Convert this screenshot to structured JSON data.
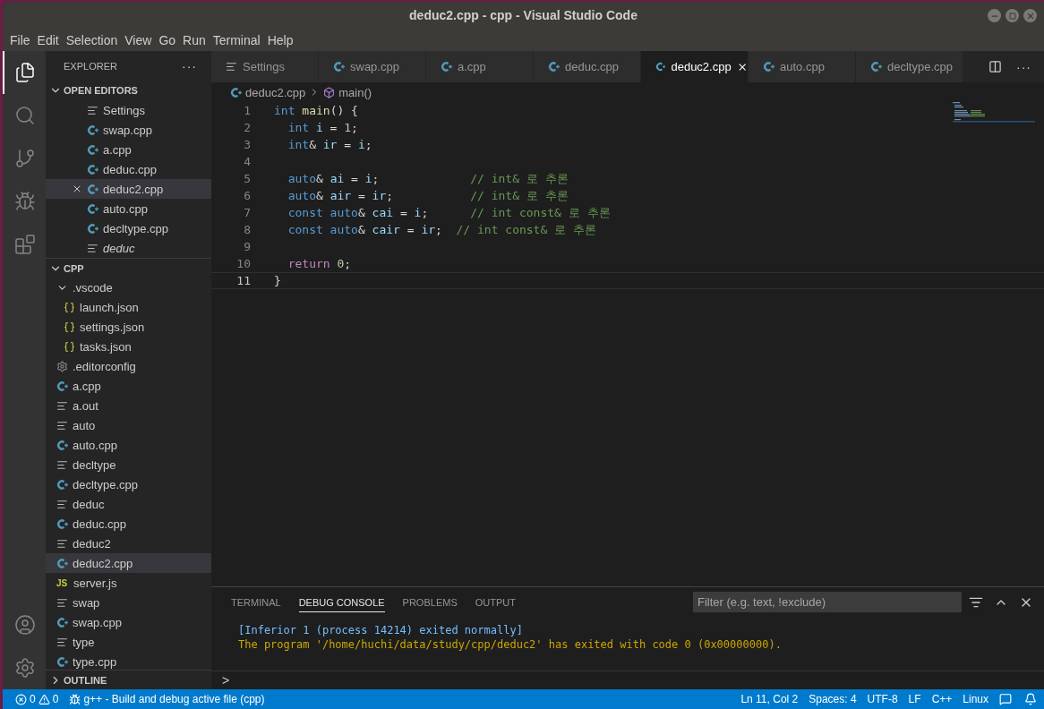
{
  "window": {
    "title": "deduc2.cpp - cpp - Visual Studio Code"
  },
  "menu": [
    "File",
    "Edit",
    "Selection",
    "View",
    "Go",
    "Run",
    "Terminal",
    "Help"
  ],
  "activity_bar": [
    {
      "kind": "files",
      "selected": true
    },
    {
      "kind": "search",
      "selected": false
    },
    {
      "kind": "source-control",
      "selected": false
    },
    {
      "kind": "debug",
      "selected": false
    },
    {
      "kind": "extensions",
      "selected": false
    }
  ],
  "sidebar": {
    "title": "EXPLORER",
    "more": "···",
    "open_editors": {
      "title": "OPEN EDITORS",
      "expanded": true,
      "items": [
        {
          "label": "Settings",
          "kind": "settings",
          "selected": false,
          "preview": false
        },
        {
          "label": "swap.cpp",
          "kind": "cpp",
          "selected": false,
          "preview": false
        },
        {
          "label": "a.cpp",
          "kind": "cpp",
          "selected": false,
          "preview": false
        },
        {
          "label": "deduc.cpp",
          "kind": "cpp",
          "selected": false,
          "preview": false
        },
        {
          "label": "deduc2.cpp",
          "kind": "cpp",
          "selected": true,
          "preview": false
        },
        {
          "label": "auto.cpp",
          "kind": "cpp",
          "selected": false,
          "preview": false
        },
        {
          "label": "decltype.cpp",
          "kind": "cpp",
          "selected": false,
          "preview": false
        },
        {
          "label": "deduc",
          "kind": "file",
          "selected": false,
          "preview": true
        }
      ]
    },
    "folder": {
      "title": "CPP",
      "expanded": true,
      "items": [
        {
          "label": ".vscode",
          "kind": "folder",
          "expanded": true,
          "selected": false,
          "children": [
            {
              "label": "launch.json",
              "kind": "json",
              "selected": false
            },
            {
              "label": "settings.json",
              "kind": "json",
              "selected": false
            },
            {
              "label": "tasks.json",
              "kind": "json",
              "selected": false
            }
          ]
        },
        {
          "label": ".editorconfig",
          "kind": "gear",
          "selected": false
        },
        {
          "label": "a.cpp",
          "kind": "cpp",
          "selected": false
        },
        {
          "label": "a.out",
          "kind": "file",
          "selected": false
        },
        {
          "label": "auto",
          "kind": "file",
          "selected": false
        },
        {
          "label": "auto.cpp",
          "kind": "cpp",
          "selected": false
        },
        {
          "label": "decltype",
          "kind": "file",
          "selected": false
        },
        {
          "label": "decltype.cpp",
          "kind": "cpp",
          "selected": false
        },
        {
          "label": "deduc",
          "kind": "file",
          "selected": false
        },
        {
          "label": "deduc.cpp",
          "kind": "cpp",
          "selected": false
        },
        {
          "label": "deduc2",
          "kind": "file",
          "selected": false
        },
        {
          "label": "deduc2.cpp",
          "kind": "cpp",
          "selected": true
        },
        {
          "label": "server.js",
          "kind": "js",
          "badge": "JS",
          "selected": false
        },
        {
          "label": "swap",
          "kind": "file",
          "selected": false
        },
        {
          "label": "swap.cpp",
          "kind": "cpp",
          "selected": false
        },
        {
          "label": "type",
          "kind": "file",
          "selected": false
        },
        {
          "label": "type.cpp",
          "kind": "cpp",
          "selected": false
        }
      ]
    },
    "outline": {
      "title": "OUTLINE",
      "expanded": false
    }
  },
  "tabs": [
    {
      "label": "Settings",
      "kind": "settings",
      "selected": false
    },
    {
      "label": "swap.cpp",
      "kind": "cpp",
      "selected": false
    },
    {
      "label": "a.cpp",
      "kind": "cpp",
      "selected": false
    },
    {
      "label": "deduc.cpp",
      "kind": "cpp",
      "selected": false
    },
    {
      "label": "deduc2.cpp",
      "kind": "cpp",
      "selected": true
    },
    {
      "label": "auto.cpp",
      "kind": "cpp",
      "selected": false
    },
    {
      "label": "decltype.cpp",
      "kind": "cpp",
      "selected": false
    }
  ],
  "tab_actions": {
    "more": "···"
  },
  "breadcrumb": {
    "file": "deduc2.cpp",
    "symbol": "main()"
  },
  "code": [
    {
      "number": "1",
      "current": false,
      "tokens": [
        {
          "text": "int ",
          "kind": "keyword"
        },
        {
          "text": "main",
          "kind": "func"
        },
        {
          "text": "() {",
          "kind": "plain"
        }
      ]
    },
    {
      "number": "2",
      "current": false,
      "tokens": [
        {
          "text": "  int ",
          "kind": "keyword"
        },
        {
          "text": "i",
          "kind": "var"
        },
        {
          "text": " = ",
          "kind": "plain"
        },
        {
          "text": "1",
          "kind": "num"
        },
        {
          "text": ";",
          "kind": "plain"
        }
      ]
    },
    {
      "number": "3",
      "current": false,
      "tokens": [
        {
          "text": "  int",
          "kind": "keyword"
        },
        {
          "text": "& ",
          "kind": "plain"
        },
        {
          "text": "ir",
          "kind": "var"
        },
        {
          "text": " = ",
          "kind": "plain"
        },
        {
          "text": "i",
          "kind": "var"
        },
        {
          "text": ";",
          "kind": "plain"
        }
      ]
    },
    {
      "number": "4",
      "current": false
    },
    {
      "number": "5",
      "current": false,
      "tokens": [
        {
          "text": "  auto",
          "kind": "keyword"
        },
        {
          "text": "& ",
          "kind": "plain"
        },
        {
          "text": "ai",
          "kind": "var"
        },
        {
          "text": " = ",
          "kind": "plain"
        },
        {
          "text": "i",
          "kind": "var"
        },
        {
          "text": ";             ",
          "kind": "plain"
        },
        {
          "text": "// int& 로 추론",
          "kind": "comment"
        }
      ]
    },
    {
      "number": "6",
      "current": false,
      "tokens": [
        {
          "text": "  auto",
          "kind": "keyword"
        },
        {
          "text": "& ",
          "kind": "plain"
        },
        {
          "text": "air",
          "kind": "var"
        },
        {
          "text": " = ",
          "kind": "plain"
        },
        {
          "text": "ir",
          "kind": "var"
        },
        {
          "text": ";           ",
          "kind": "plain"
        },
        {
          "text": "// int& 로 추론",
          "kind": "comment"
        }
      ]
    },
    {
      "number": "7",
      "current": false,
      "tokens": [
        {
          "text": "  const auto",
          "kind": "keyword"
        },
        {
          "text": "& ",
          "kind": "plain"
        },
        {
          "text": "cai",
          "kind": "var"
        },
        {
          "text": " = ",
          "kind": "plain"
        },
        {
          "text": "i",
          "kind": "var"
        },
        {
          "text": ";      ",
          "kind": "plain"
        },
        {
          "text": "// int const& 로 추론",
          "kind": "comment"
        }
      ]
    },
    {
      "number": "8",
      "current": false,
      "tokens": [
        {
          "text": "  const auto",
          "kind": "keyword"
        },
        {
          "text": "& ",
          "kind": "plain"
        },
        {
          "text": "cair",
          "kind": "var"
        },
        {
          "text": " = ",
          "kind": "plain"
        },
        {
          "text": "ir",
          "kind": "var"
        },
        {
          "text": ";  ",
          "kind": "plain"
        },
        {
          "text": "// int const& 로 추론",
          "kind": "comment"
        }
      ]
    },
    {
      "number": "9",
      "current": false
    },
    {
      "number": "10",
      "current": false,
      "tokens": [
        {
          "text": "  return ",
          "kind": "control"
        },
        {
          "text": "0",
          "kind": "num"
        },
        {
          "text": ";",
          "kind": "plain"
        }
      ]
    },
    {
      "number": "11",
      "current": true,
      "tokens": [
        {
          "text": "}",
          "kind": "plain"
        }
      ]
    }
  ],
  "panel": {
    "tabs": [
      {
        "label": "TERMINAL",
        "selected": false
      },
      {
        "label": "DEBUG CONSOLE",
        "selected": true
      },
      {
        "label": "PROBLEMS",
        "selected": false
      },
      {
        "label": "OUTPUT",
        "selected": false
      }
    ],
    "filter": {
      "placeholder": "Filter (e.g. text, !exclude)"
    },
    "output": [
      {
        "text": "[Inferior 1 (process 14214) exited normally]",
        "kind": "info"
      },
      {
        "text": "The program '/home/huchi/data/study/cpp/deduc2' has exited with code 0 (0x00000000).",
        "kind": "warning"
      }
    ],
    "prompt": ">"
  },
  "status_bar": {
    "errors": "0",
    "warnings": "0",
    "task": "g++ - Build and debug active file (cpp)",
    "right": [
      "Ln 11, Col 2",
      "Spaces: 4",
      "UTF-8",
      "LF",
      "C++",
      "Linux"
    ]
  }
}
